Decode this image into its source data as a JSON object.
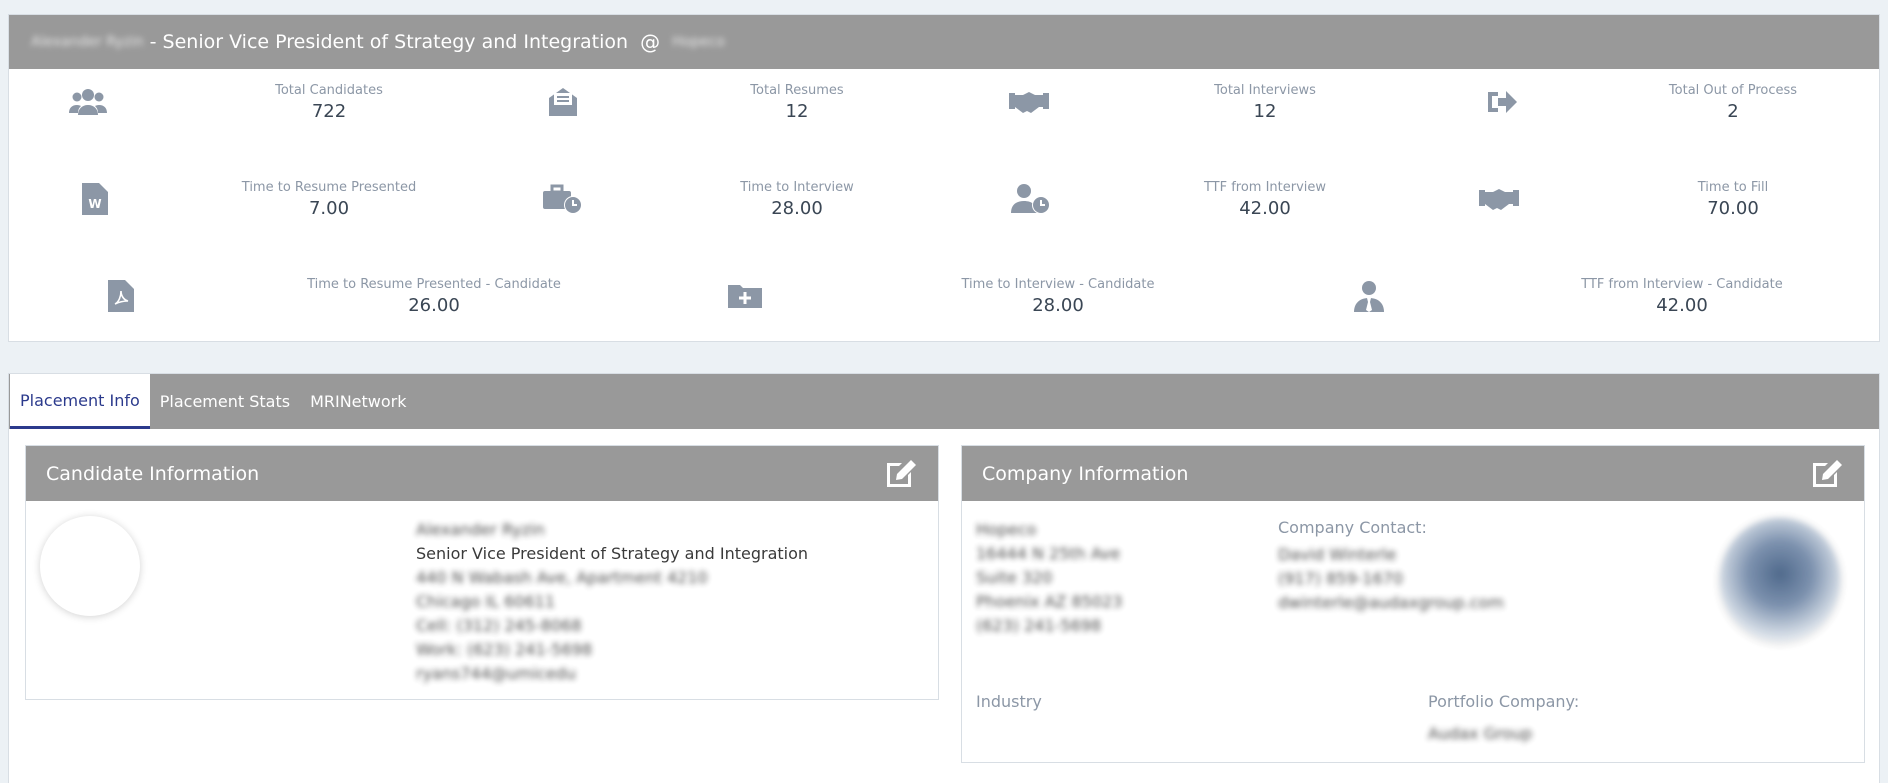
{
  "header": {
    "candidate_name": "Alexander Ryzin",
    "job_title": "- Senior Vice President of Strategy and Integration",
    "at_symbol": "@",
    "company": "Hopeco"
  },
  "stats": {
    "row1": [
      {
        "icon": "users-icon",
        "label": "Total Candidates",
        "value": "722"
      },
      {
        "icon": "envelope-open-icon",
        "label": "Total Resumes",
        "value": "12"
      },
      {
        "icon": "handshake-icon",
        "label": "Total Interviews",
        "value": "12"
      },
      {
        "icon": "sign-out-icon",
        "label": "Total Out of Process",
        "value": "2"
      }
    ],
    "row2": [
      {
        "icon": "word-file-icon",
        "label": "Time to Resume Presented",
        "value": "7.00"
      },
      {
        "icon": "briefcase-clock-icon",
        "label": "Time to Interview",
        "value": "28.00"
      },
      {
        "icon": "user-clock-icon",
        "label": "TTF from Interview",
        "value": "42.00"
      },
      {
        "icon": "handshake-icon",
        "label": "Time to Fill",
        "value": "70.00"
      }
    ],
    "row3": [
      {
        "icon": "pdf-file-icon",
        "label": "Time to Resume Presented - Candidate",
        "value": "26.00"
      },
      {
        "icon": "folder-plus-icon",
        "label": "Time to Interview - Candidate",
        "value": "28.00"
      },
      {
        "icon": "user-tie-icon",
        "label": "TTF from Interview - Candidate",
        "value": "42.00"
      }
    ]
  },
  "tabs": [
    {
      "label": "Placement Info",
      "active": true
    },
    {
      "label": "Placement Stats",
      "active": false
    },
    {
      "label": "MRINetwork",
      "active": false
    }
  ],
  "candidate_card": {
    "title": "Candidate Information",
    "name": "Alexander Ryzin",
    "job_title": "Senior Vice President of Strategy and Integration",
    "address1": "440 N Wabash Ave, Apartment 4210",
    "address2": "Chicago IL 60611",
    "cell": "Cell: (312) 245-8068",
    "work": "Work: (623) 241-5698",
    "email": "ryans744@umicedu"
  },
  "company_card": {
    "title": "Company Information",
    "company_name": "Hopeco",
    "address1": "16444 N 25th Ave",
    "address2": "Suite 320",
    "address3": "Phoenix AZ 85023",
    "phone": "(623) 241-5698",
    "contact_label": "Company Contact:",
    "contact_name": "David Winterle",
    "contact_phone": "(917) 859-1670",
    "contact_email": "dwinterle@audaxgroup.com",
    "industry_label": "Industry",
    "portfolio_label": "Portfolio Company:",
    "portfolio_value": "Audax Group"
  },
  "colors": {
    "panel_header": "#999999",
    "active_tab": "#2b3a8c",
    "icon": "#8c97a6",
    "background": "#ecf1f5"
  }
}
